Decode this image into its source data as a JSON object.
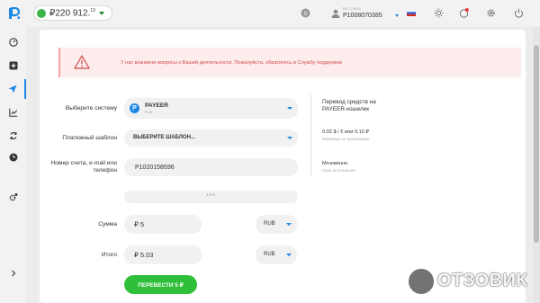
{
  "balance": {
    "currency": "₽",
    "amount": "220 912",
    "cents": "13"
  },
  "account": {
    "label": "No. счета",
    "number": "P1008070385"
  },
  "alert": {
    "text": "У нас возникли вопросы к Вашей деятельности. Пожалуйста, обратитесь в Службу поддержки"
  },
  "form": {
    "system_label": "Выберите систему",
    "system_name": "PAYEER",
    "system_sub": "RUB",
    "template_label": "Платежный шаблон",
    "template_value": "ВЫБЕРИТЕ ШАБЛОН...",
    "account_label": "Номер счета, e-mail или телефон",
    "account_value": "P1020158596",
    "more_dots": "•••",
    "amount_label": "Сумма",
    "amount_value": "₽ 5",
    "amount_currency": "RUB",
    "total_label": "Итого",
    "total_value": "₽ 5.03",
    "total_currency": "RUB",
    "submit_label": "ПЕРЕВЕСТИ 5 ₽"
  },
  "info": {
    "title": "Перевод средств на PAYEER-кошелек",
    "fee": "0.02 $ / € или 0.10 ₽",
    "fee_note": "Минимум за транзакцию",
    "speed": "Мгновенно",
    "speed_note": "Срок исполнения"
  },
  "watermark": {
    "text": "ОТЗОВИК"
  },
  "colors": {
    "accent": "#1e88e5",
    "green": "#2fbf3a",
    "alert_text": "#d24a4a",
    "alert_bg": "#fdecec"
  }
}
